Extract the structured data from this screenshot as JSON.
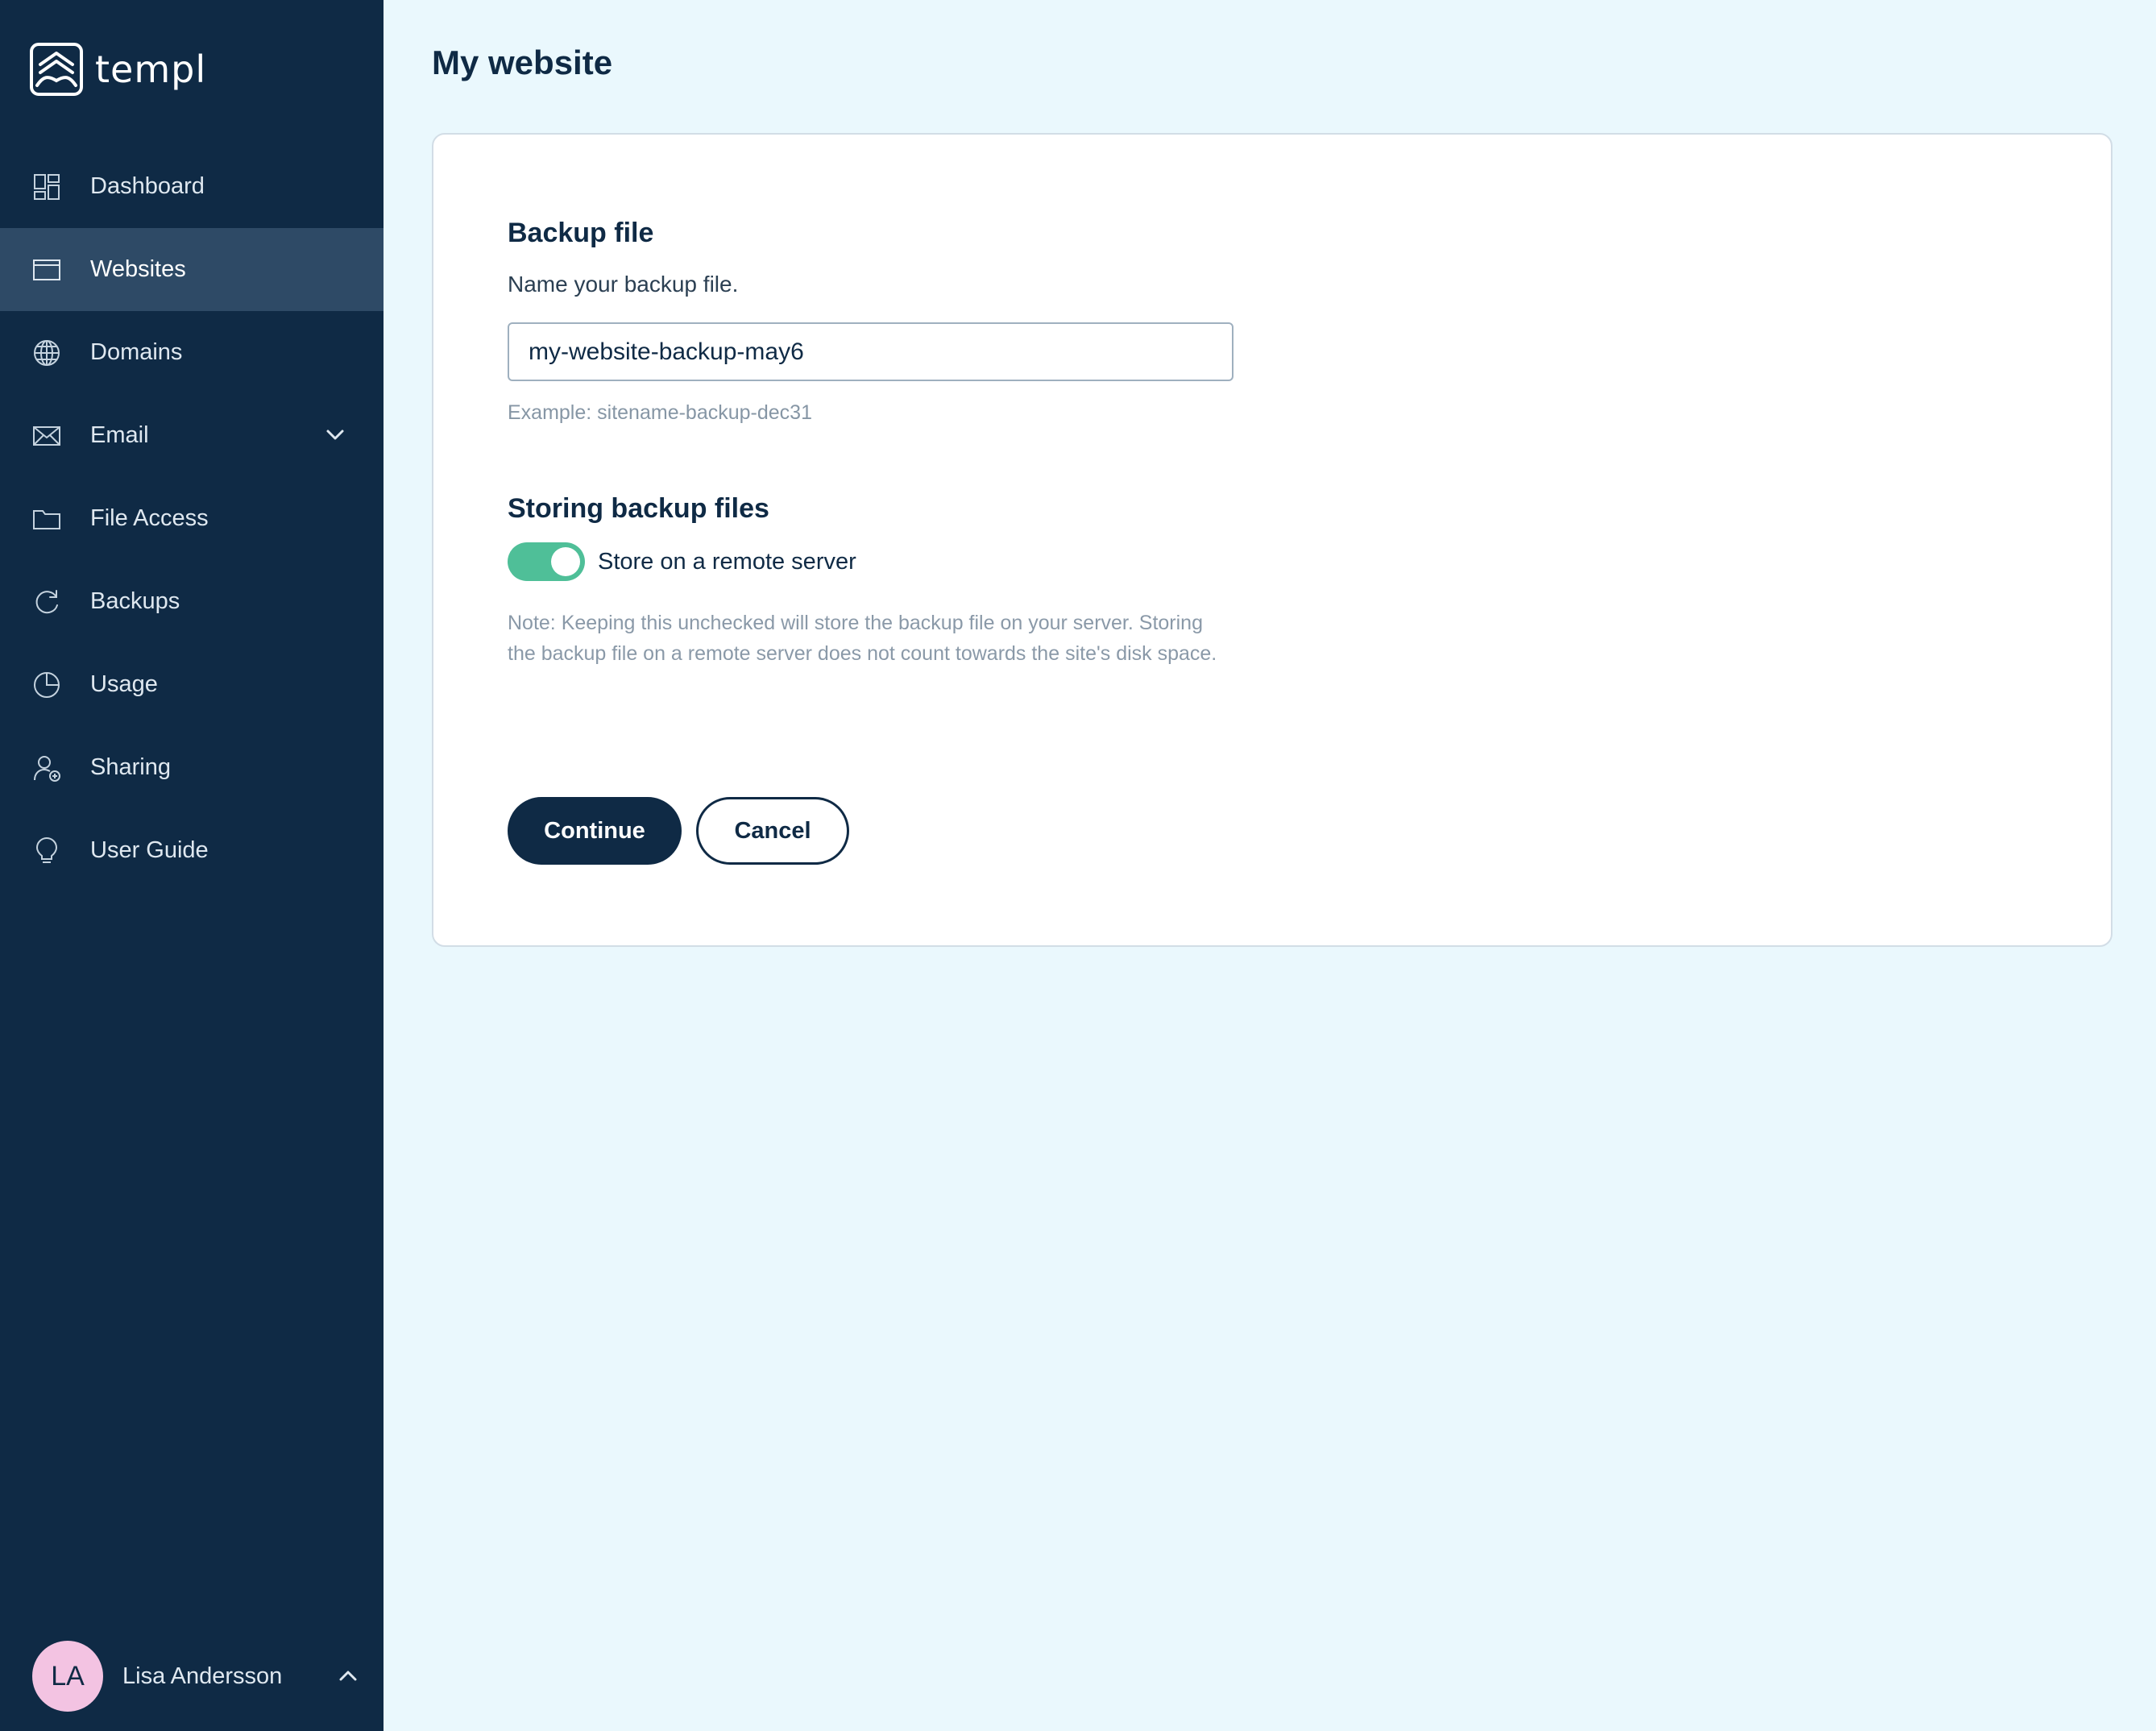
{
  "brand": {
    "name": "templ",
    "logo_icon": "templ-logo-icon"
  },
  "sidebar": {
    "items": [
      {
        "label": "Dashboard",
        "icon": "dashboard-icon",
        "active": false
      },
      {
        "label": "Websites",
        "icon": "browser-window-icon",
        "active": true
      },
      {
        "label": "Domains",
        "icon": "globe-icon",
        "active": false
      },
      {
        "label": "Email",
        "icon": "envelope-icon",
        "active": false,
        "expandable": true
      },
      {
        "label": "File Access",
        "icon": "folder-icon",
        "active": false
      },
      {
        "label": "Backups",
        "icon": "refresh-icon",
        "active": false
      },
      {
        "label": "Usage",
        "icon": "pie-chart-icon",
        "active": false
      },
      {
        "label": "Sharing",
        "icon": "user-share-icon",
        "active": false
      },
      {
        "label": "User Guide",
        "icon": "lightbulb-icon",
        "active": false
      }
    ]
  },
  "user": {
    "initials": "LA",
    "name": "Lisa Andersson"
  },
  "page": {
    "title": "My website"
  },
  "backup_form": {
    "backup_file": {
      "title": "Backup file",
      "description": "Name your backup file.",
      "input_value": "my-website-backup-may6",
      "hint": "Example: sitename-backup-dec31"
    },
    "storing": {
      "title": "Storing backup files",
      "toggle_label": "Store on a remote server",
      "toggle_on": true,
      "note": "Note: Keeping this unchecked will store the backup file on your server. Storing the backup file on a remote server does not count towards the site's disk space."
    },
    "buttons": {
      "continue": "Continue",
      "cancel": "Cancel"
    }
  },
  "colors": {
    "sidebar_bg": "#0f2a45",
    "sidebar_active_bg": "#2e4a66",
    "page_bg": "#eaf8fd",
    "toggle_on": "#4fbf98",
    "avatar_bg": "#f3c3e2"
  }
}
